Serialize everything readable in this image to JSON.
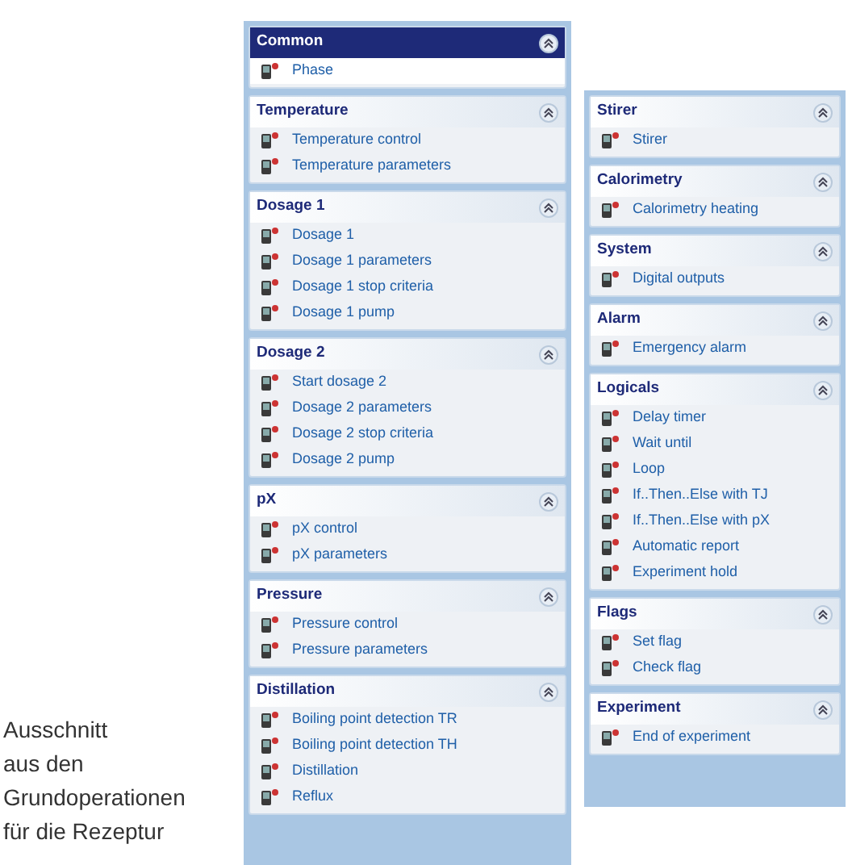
{
  "caption": [
    "Ausschnitt",
    "aus den",
    "Grundoperationen",
    "für die Rezeptur"
  ],
  "left_panel": {
    "groups": [
      {
        "title": "Common",
        "selected": true,
        "items": [
          "Phase"
        ]
      },
      {
        "title": "Temperature",
        "selected": false,
        "items": [
          "Temperature control",
          "Temperature parameters"
        ]
      },
      {
        "title": "Dosage 1",
        "selected": false,
        "items": [
          "Dosage 1",
          "Dosage 1 parameters",
          "Dosage 1 stop criteria",
          "Dosage 1 pump"
        ]
      },
      {
        "title": "Dosage 2",
        "selected": false,
        "items": [
          "Start dosage 2",
          "Dosage 2 parameters",
          "Dosage 2 stop criteria",
          "Dosage 2 pump"
        ]
      },
      {
        "title": "pX",
        "selected": false,
        "items": [
          "pX control",
          "pX parameters"
        ]
      },
      {
        "title": "Pressure",
        "selected": false,
        "items": [
          "Pressure control",
          "Pressure parameters"
        ]
      },
      {
        "title": "Distillation",
        "selected": false,
        "items": [
          "Boiling point detection TR",
          "Boiling point detection TH",
          "Distillation",
          "Reflux"
        ]
      }
    ]
  },
  "right_panel": {
    "groups": [
      {
        "title": "Stirer",
        "selected": false,
        "items": [
          "Stirer"
        ]
      },
      {
        "title": "Calorimetry",
        "selected": false,
        "items": [
          "Calorimetry heating"
        ]
      },
      {
        "title": "System",
        "selected": false,
        "items": [
          "Digital outputs"
        ]
      },
      {
        "title": "Alarm",
        "selected": false,
        "items": [
          "Emergency alarm"
        ]
      },
      {
        "title": "Logicals",
        "selected": false,
        "items": [
          "Delay timer",
          "Wait until",
          "Loop",
          "If..Then..Else with TJ",
          "If..Then..Else with pX",
          "Automatic report",
          "Experiment hold"
        ]
      },
      {
        "title": "Flags",
        "selected": false,
        "items": [
          "Set flag",
          "Check flag"
        ]
      },
      {
        "title": "Experiment",
        "selected": false,
        "items": [
          "End of experiment"
        ]
      }
    ]
  }
}
